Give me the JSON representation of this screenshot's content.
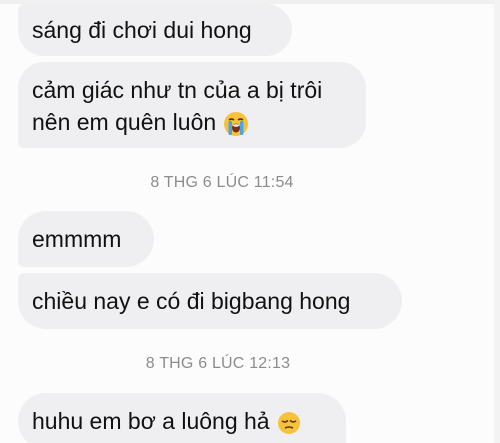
{
  "messages": [
    {
      "text": "sáng đi chơi dui hong"
    },
    {
      "line1": "cảm giác như tn của a bị trôi",
      "line2": "nên em quên luôn",
      "emoji": "loudly-crying-face-icon"
    },
    {
      "text": "emmmm"
    },
    {
      "text": "chiều nay e có đi bigbang hong"
    },
    {
      "text": "huhu em bơ a luông hả",
      "emoji": "pensive-face-icon"
    }
  ],
  "timestamps": [
    "8 THG 6 LÚC 11:54",
    "8 THG 6 LÚC 12:13"
  ],
  "colors": {
    "bubble_bg": "#efeff1",
    "text": "#111111",
    "timestamp": "#8c8c8c",
    "emoji_yellow": "#f7c23a",
    "tears_blue": "#4aa3e8"
  }
}
